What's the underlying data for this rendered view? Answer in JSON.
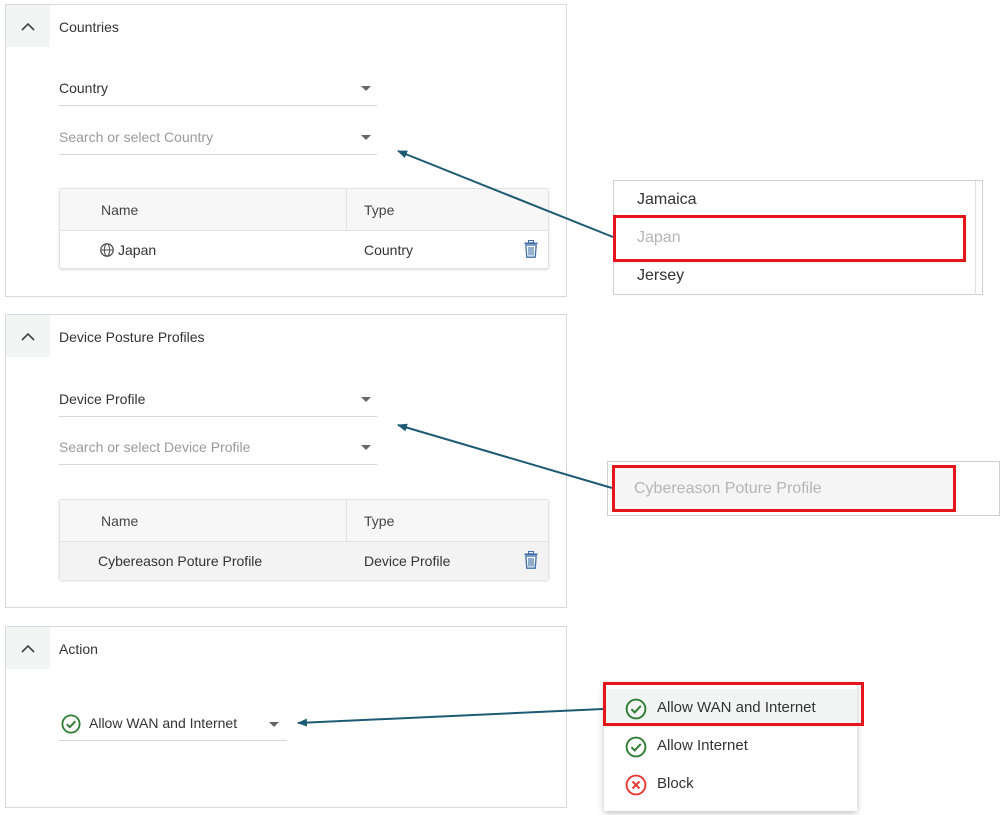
{
  "countries": {
    "title": "Countries",
    "type_select": "Country",
    "search_placeholder": "Search or select Country",
    "table": {
      "headers": [
        "Name",
        "Type"
      ],
      "rows": [
        {
          "name": "Japan",
          "type": "Country",
          "icon": "globe-icon"
        }
      ]
    }
  },
  "device": {
    "title": "Device Posture Profiles",
    "type_select": "Device Profile",
    "search_placeholder": "Search or select Device Profile",
    "table": {
      "headers": [
        "Name",
        "Type"
      ],
      "rows": [
        {
          "name": "Cybereason Poture Profile",
          "type": "Device Profile"
        }
      ]
    }
  },
  "action": {
    "title": "Action",
    "selected": "Allow WAN and Internet",
    "selected_icon": "check-circle-icon"
  },
  "country_dropdown": {
    "options": [
      {
        "label": "Jamaica"
      },
      {
        "label": "Japan",
        "state": "disabled"
      },
      {
        "label": "Jersey"
      }
    ]
  },
  "device_dropdown": {
    "options": [
      {
        "label": "Cybereason Poture Profile",
        "state": "disabled"
      }
    ]
  },
  "action_dropdown": {
    "options": [
      {
        "label": "Allow WAN and Internet",
        "icon": "check-circle-icon"
      },
      {
        "label": "Allow Internet",
        "icon": "check-circle-icon"
      },
      {
        "label": "Block",
        "icon": "x-circle-icon"
      }
    ]
  },
  "colors": {
    "highlight": "#e8141b",
    "arrow": "#1d5a73",
    "allow": "#2e7d32",
    "block": "#e53935",
    "trash": "#3f6fa8"
  }
}
